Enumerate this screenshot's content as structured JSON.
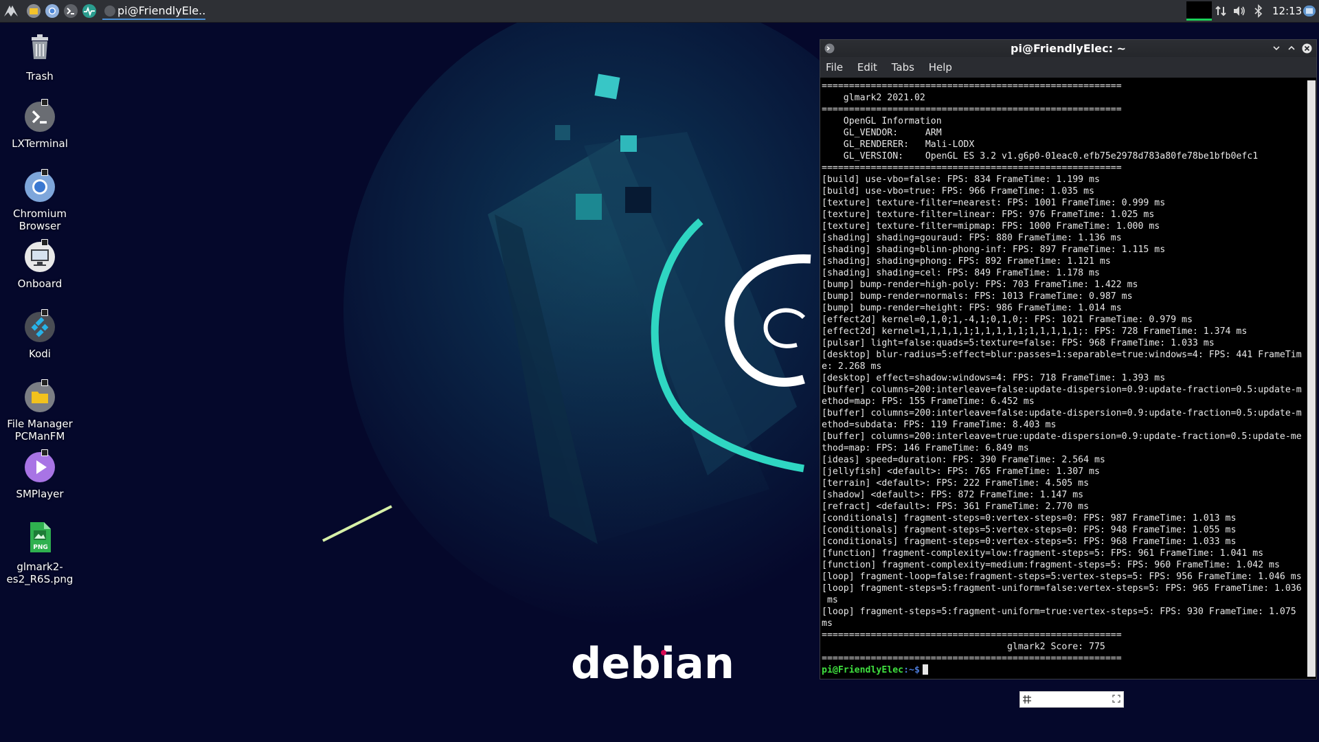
{
  "taskbar": {
    "task_label": "pi@FriendlyEle...",
    "clock": "12:13"
  },
  "desktop": {
    "icons": [
      {
        "label": "Trash",
        "icon": "trash-icon"
      },
      {
        "label": "LXTerminal",
        "icon": "terminal-icon"
      },
      {
        "label": "Chromium Browser",
        "icon": "chromium-icon"
      },
      {
        "label": "Onboard",
        "icon": "onboard-keyboard-icon"
      },
      {
        "label": "Kodi",
        "icon": "kodi-icon"
      },
      {
        "label": "File Manager PCManFM",
        "icon": "folder-icon"
      },
      {
        "label": "SMPlayer",
        "icon": "play-icon"
      },
      {
        "label": "glmark2-es2_R6S.png",
        "icon": "png-file-icon"
      }
    ],
    "wallpaper_text": "debian"
  },
  "terminal": {
    "title": "pi@FriendlyElec: ~",
    "menu": [
      "File",
      "Edit",
      "Tabs",
      "Help"
    ],
    "lines": [
      "=======================================================",
      "    glmark2 2021.02",
      "=======================================================",
      "    OpenGL Information",
      "    GL_VENDOR:     ARM",
      "    GL_RENDERER:   Mali-LODX",
      "    GL_VERSION:    OpenGL ES 3.2 v1.g6p0-01eac0.efb75e2978d783a80fe78be1bfb0efc1",
      "=======================================================",
      "[build] use-vbo=false: FPS: 834 FrameTime: 1.199 ms",
      "[build] use-vbo=true: FPS: 966 FrameTime: 1.035 ms",
      "[texture] texture-filter=nearest: FPS: 1001 FrameTime: 0.999 ms",
      "[texture] texture-filter=linear: FPS: 976 FrameTime: 1.025 ms",
      "[texture] texture-filter=mipmap: FPS: 1000 FrameTime: 1.000 ms",
      "[shading] shading=gouraud: FPS: 880 FrameTime: 1.136 ms",
      "[shading] shading=blinn-phong-inf: FPS: 897 FrameTime: 1.115 ms",
      "[shading] shading=phong: FPS: 892 FrameTime: 1.121 ms",
      "[shading] shading=cel: FPS: 849 FrameTime: 1.178 ms",
      "[bump] bump-render=high-poly: FPS: 703 FrameTime: 1.422 ms",
      "[bump] bump-render=normals: FPS: 1013 FrameTime: 0.987 ms",
      "[bump] bump-render=height: FPS: 986 FrameTime: 1.014 ms",
      "[effect2d] kernel=0,1,0;1,-4,1;0,1,0;: FPS: 1021 FrameTime: 0.979 ms",
      "[effect2d] kernel=1,1,1,1,1;1,1,1,1,1;1,1,1,1,1;: FPS: 728 FrameTime: 1.374 ms",
      "[pulsar] light=false:quads=5:texture=false: FPS: 968 FrameTime: 1.033 ms",
      "[desktop] blur-radius=5:effect=blur:passes=1:separable=true:windows=4: FPS: 441 FrameTim",
      "e: 2.268 ms",
      "[desktop] effect=shadow:windows=4: FPS: 718 FrameTime: 1.393 ms",
      "[buffer] columns=200:interleave=false:update-dispersion=0.9:update-fraction=0.5:update-m",
      "ethod=map: FPS: 155 FrameTime: 6.452 ms",
      "[buffer] columns=200:interleave=false:update-dispersion=0.9:update-fraction=0.5:update-m",
      "ethod=subdata: FPS: 119 FrameTime: 8.403 ms",
      "[buffer] columns=200:interleave=true:update-dispersion=0.9:update-fraction=0.5:update-me",
      "thod=map: FPS: 146 FrameTime: 6.849 ms",
      "[ideas] speed=duration: FPS: 390 FrameTime: 2.564 ms",
      "[jellyfish] <default>: FPS: 765 FrameTime: 1.307 ms",
      "[terrain] <default>: FPS: 222 FrameTime: 4.505 ms",
      "[shadow] <default>: FPS: 872 FrameTime: 1.147 ms",
      "[refract] <default>: FPS: 361 FrameTime: 2.770 ms",
      "[conditionals] fragment-steps=0:vertex-steps=0: FPS: 987 FrameTime: 1.013 ms",
      "[conditionals] fragment-steps=5:vertex-steps=0: FPS: 948 FrameTime: 1.055 ms",
      "[conditionals] fragment-steps=0:vertex-steps=5: FPS: 968 FrameTime: 1.033 ms",
      "[function] fragment-complexity=low:fragment-steps=5: FPS: 961 FrameTime: 1.041 ms",
      "[function] fragment-complexity=medium:fragment-steps=5: FPS: 960 FrameTime: 1.042 ms",
      "[loop] fragment-loop=false:fragment-steps=5:vertex-steps=5: FPS: 956 FrameTime: 1.046 ms",
      "[loop] fragment-steps=5:fragment-uniform=false:vertex-steps=5: FPS: 965 FrameTime: 1.036",
      " ms",
      "[loop] fragment-steps=5:fragment-uniform=true:vertex-steps=5: FPS: 930 FrameTime: 1.075",
      "ms",
      "=======================================================",
      "                                  glmark2 Score: 775",
      "======================================================="
    ],
    "prompt_user": "pi@FriendlyElec",
    "prompt_path": ":~$"
  }
}
